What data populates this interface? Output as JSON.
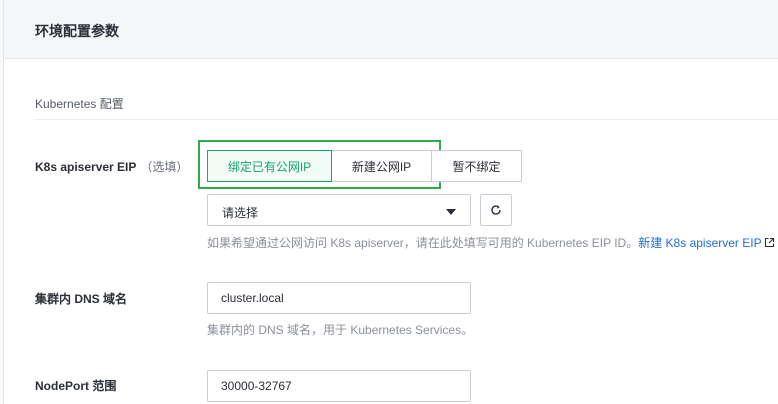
{
  "panel": {
    "title": "环境配置参数"
  },
  "section": {
    "title": "Kubernetes 配置"
  },
  "eip_field": {
    "label": "K8s apiserver EIP",
    "optional": "（选填）",
    "options": [
      "绑定已有公网IP",
      "新建公网IP",
      "暂不绑定"
    ],
    "selected_option": "绑定已有公网IP",
    "select_placeholder": "请选择",
    "hint_text": "如果希望通过公网访问 K8s apiserver，请在此处填写可用的 Kubernetes EIP ID。",
    "hint_link": "新建 K8s apiserver EIP",
    "icons": {
      "caret": "caret-down-icon",
      "refresh": "refresh-icon",
      "external_link": "external-link-icon"
    }
  },
  "dns_field": {
    "label": "集群内 DNS 域名",
    "value": "cluster.local",
    "hint_text": "集群内的 DNS 域名，用于 Kubernetes Services。"
  },
  "nodeport_field": {
    "label": "NodePort 范围",
    "value": "30000-32767"
  },
  "colors": {
    "accent_green": "#16a56d",
    "highlight_outline": "#2eaa4a",
    "link_blue": "#1f6fd2"
  }
}
